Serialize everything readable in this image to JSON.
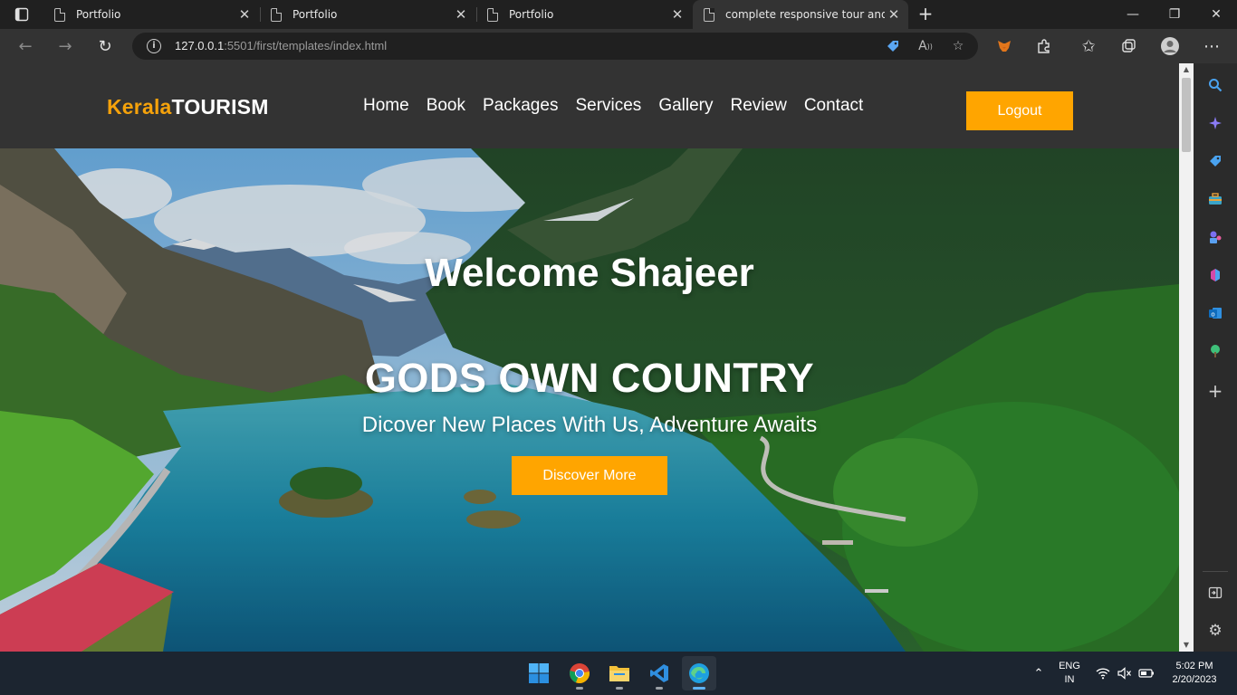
{
  "browser": {
    "tabs": [
      {
        "title": "Portfolio",
        "active": false
      },
      {
        "title": "Portfolio",
        "active": false
      },
      {
        "title": "Portfolio",
        "active": false
      },
      {
        "title": "complete responsive tour and tra",
        "active": true
      }
    ],
    "url_host": "127.0.0.1",
    "url_rest": ":5501/first/templates/index.html",
    "window_controls": {
      "minimize": "—",
      "restore": "❐",
      "close": "✕"
    }
  },
  "site": {
    "logo_part1": "Kerala",
    "logo_part2": "TOURISM",
    "nav": [
      "Home",
      "Book",
      "Packages",
      "Services",
      "Gallery",
      "Review",
      "Contact"
    ],
    "logout_label": "Logout",
    "hero": {
      "welcome": "Welcome Shajeer",
      "headline": "GODS OWN COUNTRY",
      "tagline": "Dicover New Places With Us, Adventure Awaits",
      "cta": "Discover More"
    },
    "colors": {
      "accent": "#ffa500",
      "header_bg": "#333333"
    }
  },
  "taskbar": {
    "language_line1": "ENG",
    "language_line2": "IN",
    "time": "5:02 PM",
    "date": "2/20/2023"
  }
}
